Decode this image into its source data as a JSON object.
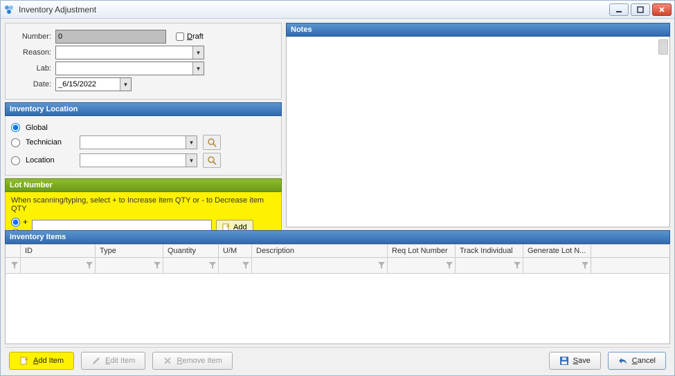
{
  "window": {
    "title": "Inventory Adjustment"
  },
  "form": {
    "number_label": "Number:",
    "number_value": "0",
    "draft_label": "Draft",
    "reason_label": "Reason:",
    "reason_value": "",
    "lab_label": "Lab:",
    "lab_value": "",
    "date_label": "Date:",
    "date_value": "_6/15/2022"
  },
  "inv_loc": {
    "header": "Inventory Location",
    "global": "Global",
    "technician": "Technician",
    "location": "Location",
    "selected": "global",
    "technician_value": "",
    "location_value": ""
  },
  "lot": {
    "header": "Lot Number",
    "hint": "When scanning/typing, select + to Increase item QTY or - to Decrease item QTY",
    "plus": "+",
    "minus": "–",
    "selected_sign": "plus",
    "input_value": "",
    "add_label": "Add"
  },
  "notes": {
    "header": "Notes",
    "value": ""
  },
  "items": {
    "header": "Inventory Items",
    "columns": {
      "id": "ID",
      "type": "Type",
      "qty": "Quantity",
      "um": "U/M",
      "desc": "Description",
      "req": "Req Lot Number",
      "trk": "Track Individual",
      "gen": "Generate Lot N..."
    },
    "rows": []
  },
  "buttons": {
    "add_item": "Add Item",
    "edit_item": "Edit Item",
    "remove_item": "Remove Item",
    "save": "Save",
    "cancel": "Cancel"
  }
}
